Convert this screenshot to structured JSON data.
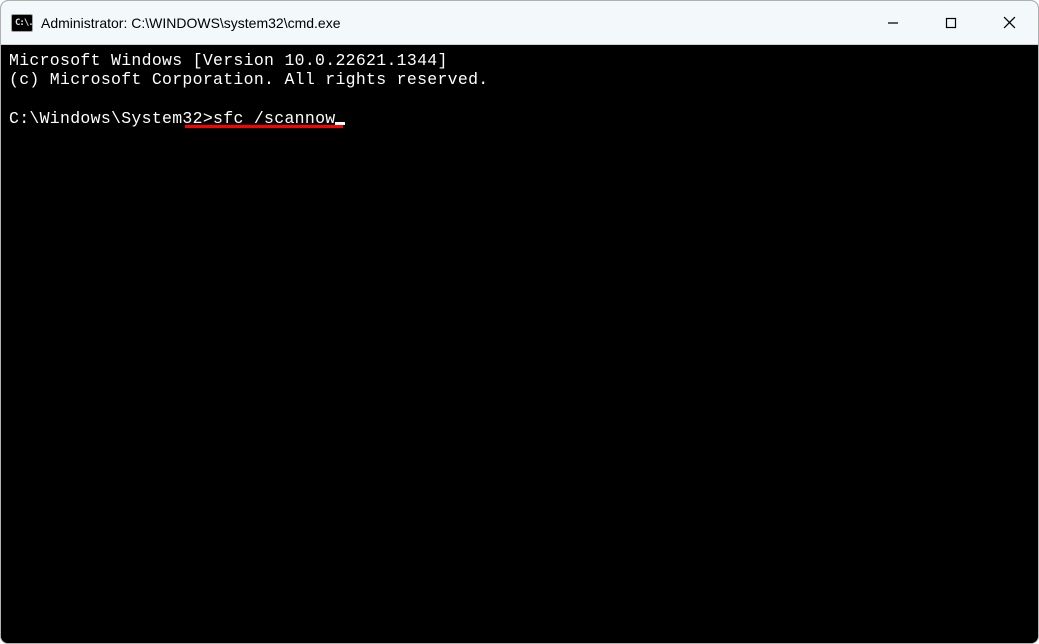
{
  "window": {
    "title": "Administrator: C:\\WINDOWS\\system32\\cmd.exe"
  },
  "terminal": {
    "line1": "Microsoft Windows [Version 10.0.22621.1344]",
    "line2": "(c) Microsoft Corporation. All rights reserved.",
    "prompt": "C:\\Windows\\System32>",
    "command": "sfc /scannow",
    "cmd_icon_text": "C:\\."
  },
  "underline": {
    "color": "#ff0000"
  }
}
